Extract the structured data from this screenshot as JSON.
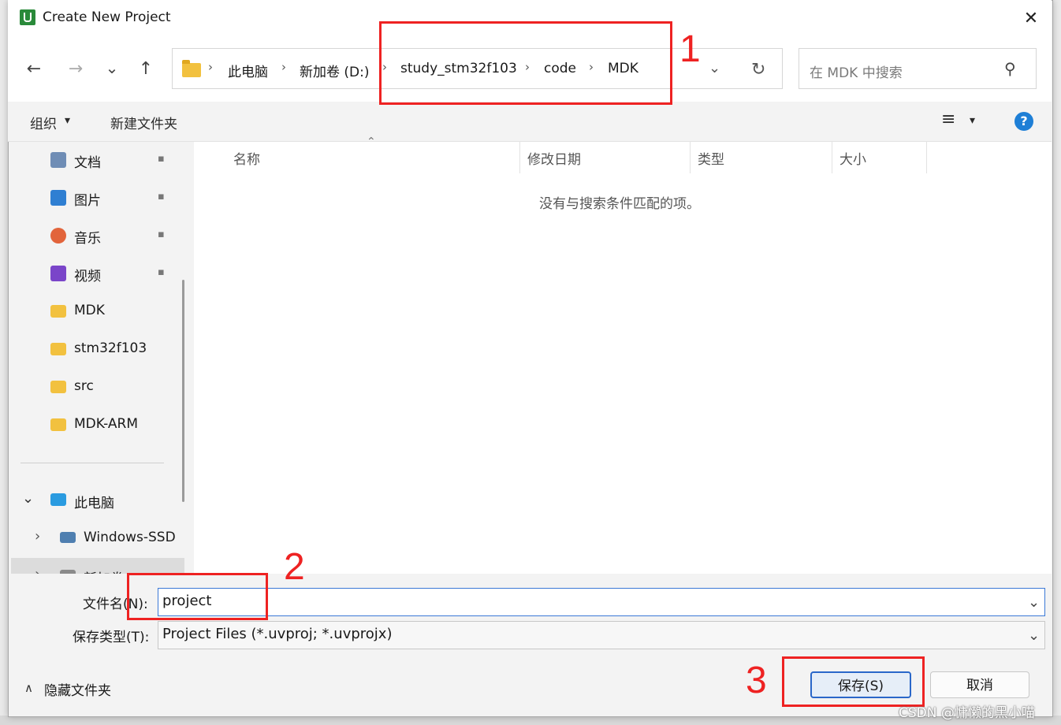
{
  "window": {
    "title": "Create New Project",
    "close_symbol": "✕"
  },
  "nav": {
    "back_symbol": "←",
    "forward_symbol": "→",
    "recent_symbol": "⌄",
    "up_symbol": "↑",
    "breadcrumbs": [
      "此电脑",
      "新加卷 (D:)",
      "study_stm32f103",
      "code",
      "MDK"
    ],
    "breadcrumb_separator": "›",
    "dropdown_symbol": "⌄",
    "refresh_symbol": "↻",
    "search_placeholder": "在 MDK 中搜索",
    "search_symbol": "⚲"
  },
  "toolbar": {
    "organize_label": "组织",
    "organize_caret": "▾",
    "new_folder_label": "新建文件夹",
    "view_symbol": "≡",
    "view_caret": "▾",
    "help_symbol": "?"
  },
  "sidebar": {
    "quick": [
      {
        "label": "文档",
        "icon": "document-icon",
        "color": "#6f8db5",
        "pinned": true
      },
      {
        "label": "图片",
        "icon": "pictures-icon",
        "color": "#2f7fd2",
        "pinned": true
      },
      {
        "label": "音乐",
        "icon": "music-icon",
        "color": "#e2643b",
        "pinned": true
      },
      {
        "label": "视频",
        "icon": "video-icon",
        "color": "#7a45c9",
        "pinned": true
      },
      {
        "label": "MDK",
        "icon": "folder-icon",
        "color": "#f2c13f",
        "pinned": false
      },
      {
        "label": "stm32f103",
        "icon": "folder-icon",
        "color": "#f2c13f",
        "pinned": false
      },
      {
        "label": "src",
        "icon": "folder-icon",
        "color": "#f2c13f",
        "pinned": false
      },
      {
        "label": "MDK-ARM",
        "icon": "folder-icon",
        "color": "#f2c13f",
        "pinned": false
      }
    ],
    "pin_symbol": "📌",
    "this_pc": {
      "label": "此电脑",
      "expand_symbol": "⌄"
    },
    "drives": [
      {
        "label": "Windows-SSD",
        "expand_symbol": "›"
      },
      {
        "label": "新加卷 (D:)",
        "expand_symbol": "›"
      }
    ]
  },
  "list": {
    "sort_caret": "⌃",
    "columns": [
      "名称",
      "修改日期",
      "类型",
      "大小"
    ],
    "empty_message": "没有与搜索条件匹配的项。"
  },
  "form": {
    "filename_label": "文件名(N):",
    "filename_value": "project",
    "filetype_label": "保存类型(T):",
    "filetype_value": "Project Files (*.uvproj; *.uvprojx)",
    "dropdown_symbol": "⌄"
  },
  "footer": {
    "hide_folders_label": "隐藏文件夹",
    "hide_caret": "∧",
    "save_label": "保存(S)",
    "cancel_label": "取消"
  },
  "annotations": {
    "marker_1": "1",
    "marker_2": "2",
    "marker_3": "3",
    "color": "#ee2222"
  },
  "watermark": "CSDN @慵懒的黑小喵"
}
